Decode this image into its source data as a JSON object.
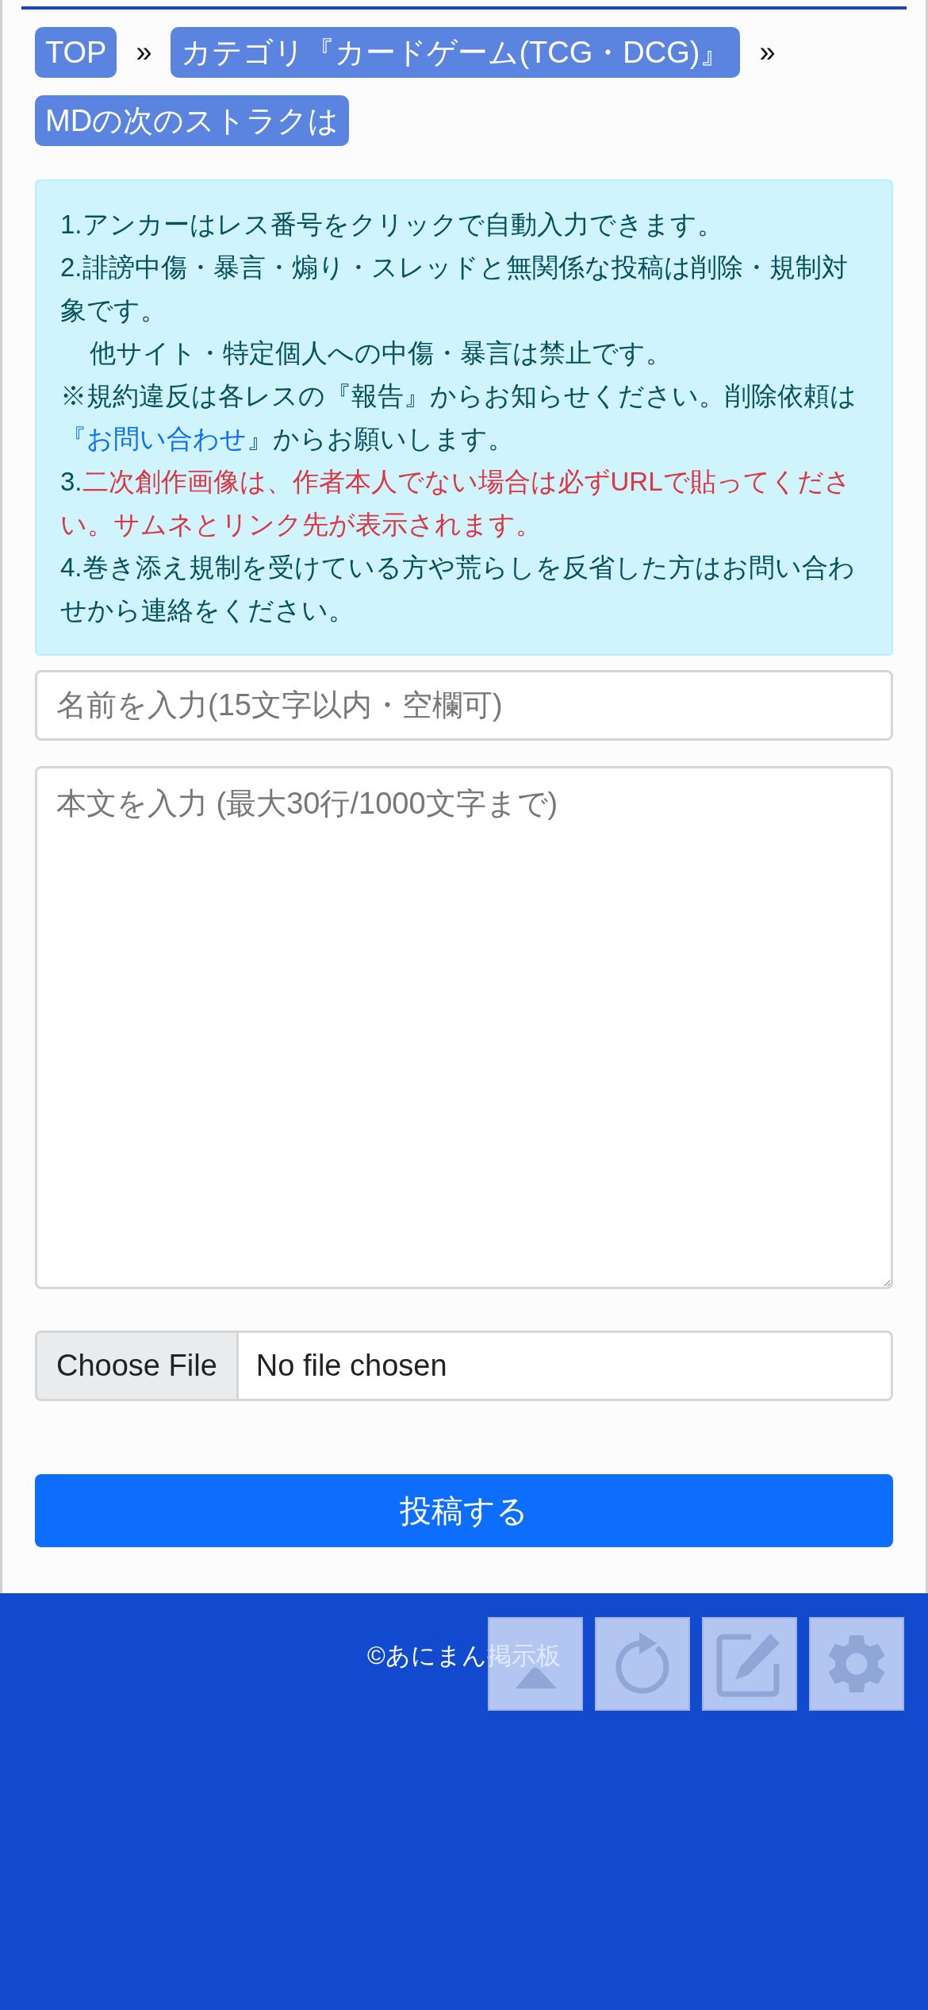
{
  "breadcrumbs": [
    {
      "kind": "crumb",
      "label": "TOP"
    },
    {
      "kind": "separator",
      "label": "»"
    },
    {
      "kind": "crumb",
      "label": "カテゴリ『カードゲーム(TCG・DCG)』"
    },
    {
      "kind": "separator",
      "label": "»"
    },
    {
      "kind": "crumb",
      "label": "MDの次のストラクは"
    }
  ],
  "notice": [
    {
      "kind": "plain",
      "segments": [
        {
          "kind": "plain",
          "text": "1.アンカーはレス番号をクリックで自動入力できます。"
        }
      ]
    },
    {
      "kind": "plain",
      "segments": [
        {
          "kind": "plain",
          "text": "2.誹謗中傷・暴言・煽り・スレッドと無関係な投稿は削除・規制対象です。"
        }
      ]
    },
    {
      "kind": "indented",
      "segments": [
        {
          "kind": "plain",
          "text": "他サイト・特定個人への中傷・暴言は禁止です。"
        }
      ]
    },
    {
      "kind": "plain",
      "segments": [
        {
          "kind": "plain",
          "text": "※規約違反は各レスの『報告』からお知らせください。削除依頼は"
        },
        {
          "kind": "link",
          "text": "『お問い合わせ"
        },
        {
          "kind": "plain",
          "text": "』からお願いします。"
        }
      ]
    },
    {
      "kind": "plain",
      "segments": [
        {
          "kind": "plain",
          "text": "3."
        },
        {
          "kind": "warning",
          "text": "二次創作画像は、作者本人でない場合は必ずURLで貼ってください。サムネとリンク先が表示されます。"
        }
      ]
    },
    {
      "kind": "plain",
      "segments": [
        {
          "kind": "plain",
          "text": "4.巻き添え規制を受けている方や荒らしを反省した方はお問い合わせから連絡をください。"
        }
      ]
    }
  ],
  "name_field": {
    "placeholder": "名前を入力(15文字以内・空欄可)"
  },
  "body_field": {
    "placeholder": "本文を入力 (最大30行/1000文字まで)"
  },
  "file_input": {
    "button": "Choose File",
    "status": "No file chosen"
  },
  "submit_button": "投稿する",
  "footer": {
    "copyright": "©あにまん掲示板"
  },
  "floating_buttons": [
    {
      "kind": "top"
    },
    {
      "kind": "reload"
    },
    {
      "kind": "edit"
    },
    {
      "kind": "settings"
    }
  ]
}
